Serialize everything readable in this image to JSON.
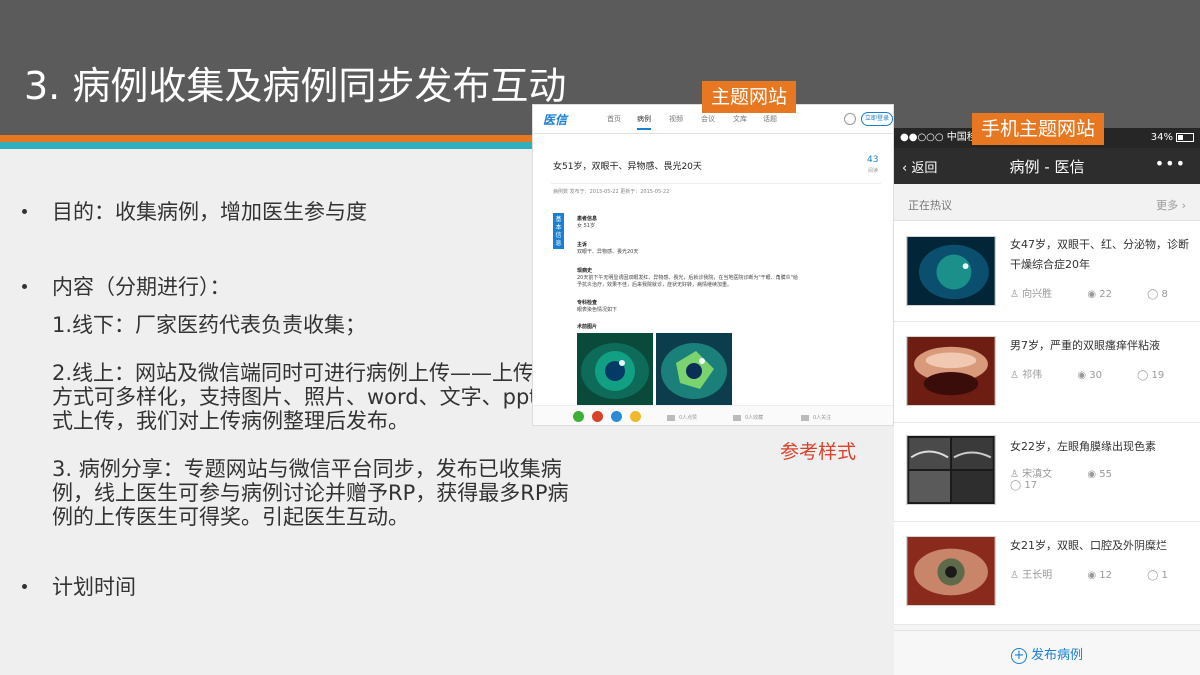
{
  "slide": {
    "title": "3. 病例收集及病例同步发布互动",
    "bullets": {
      "b1": "目的：收集病例，增加医生参与度",
      "b2": "内容（分期进行）：",
      "b2_sub1": "1.线下：厂家医药代表负责收集；",
      "b2_sub2": "2.线上：网站及微信端同时可进行病例上传——上传病例方式可多样化，支持图片、照片、word、文字、ppt等形式上传，我们对上传病例整理后发布。",
      "b2_sub3": "3. 病例分享：专题网站与微信平台同步，发布已收集病例，线上医生可参与病例讨论并赠予RP，获得最多RP病例的上传医生可得奖。引起医生互动。",
      "b3": "计划时间"
    },
    "tags": {
      "website": "主题网站",
      "mobile": "手机主题网站",
      "reference": "参考样式"
    }
  },
  "website": {
    "logo": "医信",
    "nav": [
      "首页",
      "病例",
      "视频",
      "会议",
      "文库",
      "话题"
    ],
    "login": "立即登录",
    "case_title": "女51岁，双眼干、异物感、畏光20天",
    "view_count": "43",
    "view_label": "阅读",
    "meta": "病例数  发布于：2015-05-22  更新于：2015-05-22",
    "side_tab": "基本信息",
    "sections": [
      {
        "heading": "患者信息",
        "text": "女 51岁"
      },
      {
        "heading": "主诉",
        "text": "双眼干、异物感、畏光20天"
      },
      {
        "heading": "现病史",
        "text": "20天前下午无明显诱因双眼发红、异物感、畏光，后就诊我院，在当地医院诊断为\"干眼、角膜炎\"给予抗炎治疗，效果不佳，后来我院就诊，症状无好转，病情继续加重。"
      },
      {
        "heading": "专科检查",
        "text": "眼表染色情况如下"
      },
      {
        "heading": "术前图片",
        "text": ""
      }
    ],
    "actions": [
      "0人点赞",
      "0人收藏",
      "0人关注"
    ]
  },
  "phone": {
    "carrier": "●●○○○ 中国移动",
    "battery": "34%",
    "back": "返回",
    "title": "病例 - 医信",
    "hot_label": "正在热议",
    "more": "更多",
    "items": [
      {
        "title": "女47岁，双眼干、红、分泌物，诊断干燥综合症20年",
        "author": "向兴胜",
        "views": "22",
        "comments": "8"
      },
      {
        "title": "男7岁，严重的双眼瘙痒伴粘液",
        "author": "祁伟",
        "views": "30",
        "comments": "19"
      },
      {
        "title": "女22岁，左眼角膜缘出现色素",
        "author": "宋滇文",
        "views": "55",
        "comments": "17"
      },
      {
        "title": "女21岁，双眼、口腔及外阴糜烂",
        "author": "王长明",
        "views": "12",
        "comments": "1"
      }
    ],
    "post_button": "发布病例"
  },
  "colors": {
    "header": "#5b5b5b",
    "orange": "#e87722",
    "teal": "#2fb1bd",
    "reference_red": "#d9412b",
    "link_blue": "#1a7fd1"
  }
}
